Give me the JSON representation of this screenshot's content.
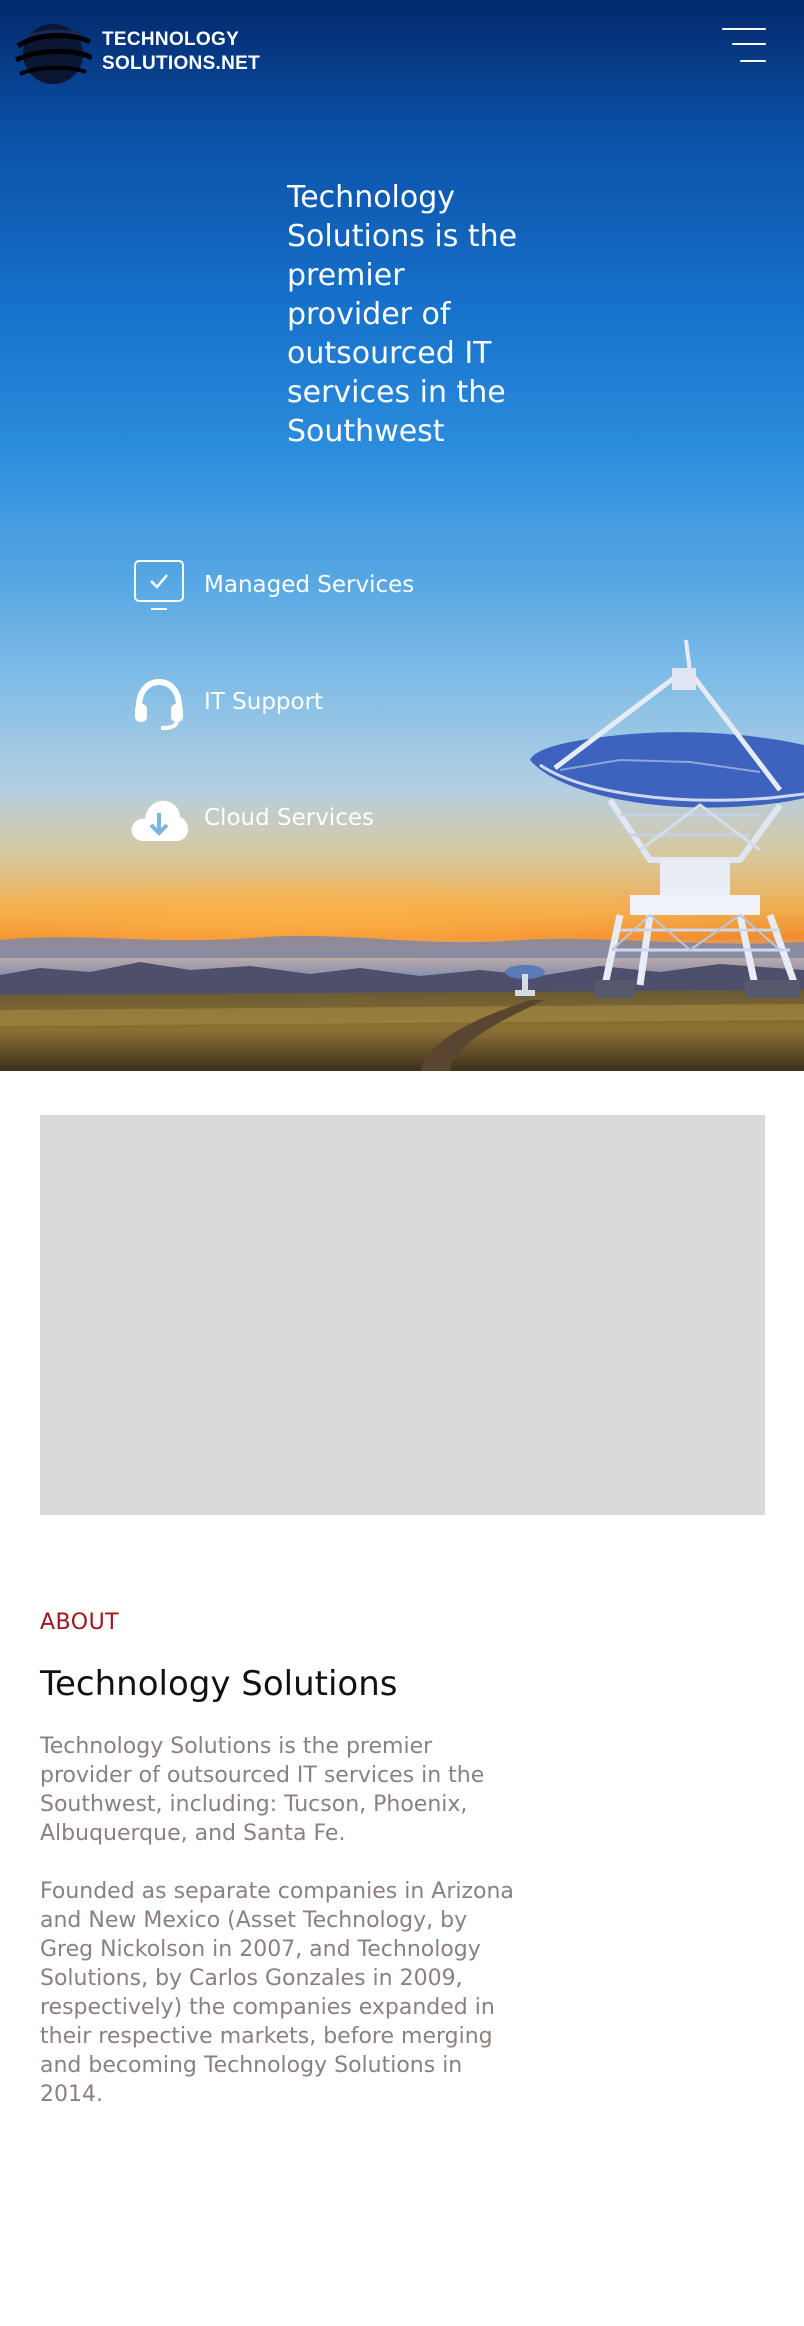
{
  "header": {
    "logo_line1": "TECHNOLOGY",
    "logo_line2": "SOLUTIONS.NET",
    "logo_icon": "globe-icon",
    "menu_icon": "hamburger-menu-icon"
  },
  "hero": {
    "tagline": "Technology\nSolutions is the\npremier\n provider of\noutsourced IT\nservices in the\n Southwest",
    "services": [
      {
        "label": "Managed Services",
        "icon": "monitor-check-icon"
      },
      {
        "label": "IT Support",
        "icon": "headset-icon"
      },
      {
        "label": "Cloud Services",
        "icon": "cloud-download-icon"
      }
    ]
  },
  "about": {
    "eyebrow": "ABOUT",
    "title": "Technology Solutions",
    "paragraph1": "Technology Solutions is the premier provider of outsourced IT services in the Southwest, including: Tucson, Phoenix, Albuquerque, and Santa Fe.",
    "paragraph2": "Founded as separate companies in Arizona and New Mexico (Asset Technology, by Greg Nickolson in 2007, and Technology Solutions, by Carlos Gonzales in 2009, respectively) the companies expanded in their respective markets, before merging and becoming Technology Solutions in 2014."
  },
  "colors": {
    "accent": "#a0161c",
    "body_text": "#8b7f7f",
    "placeholder": "#d9d9d9",
    "sky_top": "#02296a"
  }
}
